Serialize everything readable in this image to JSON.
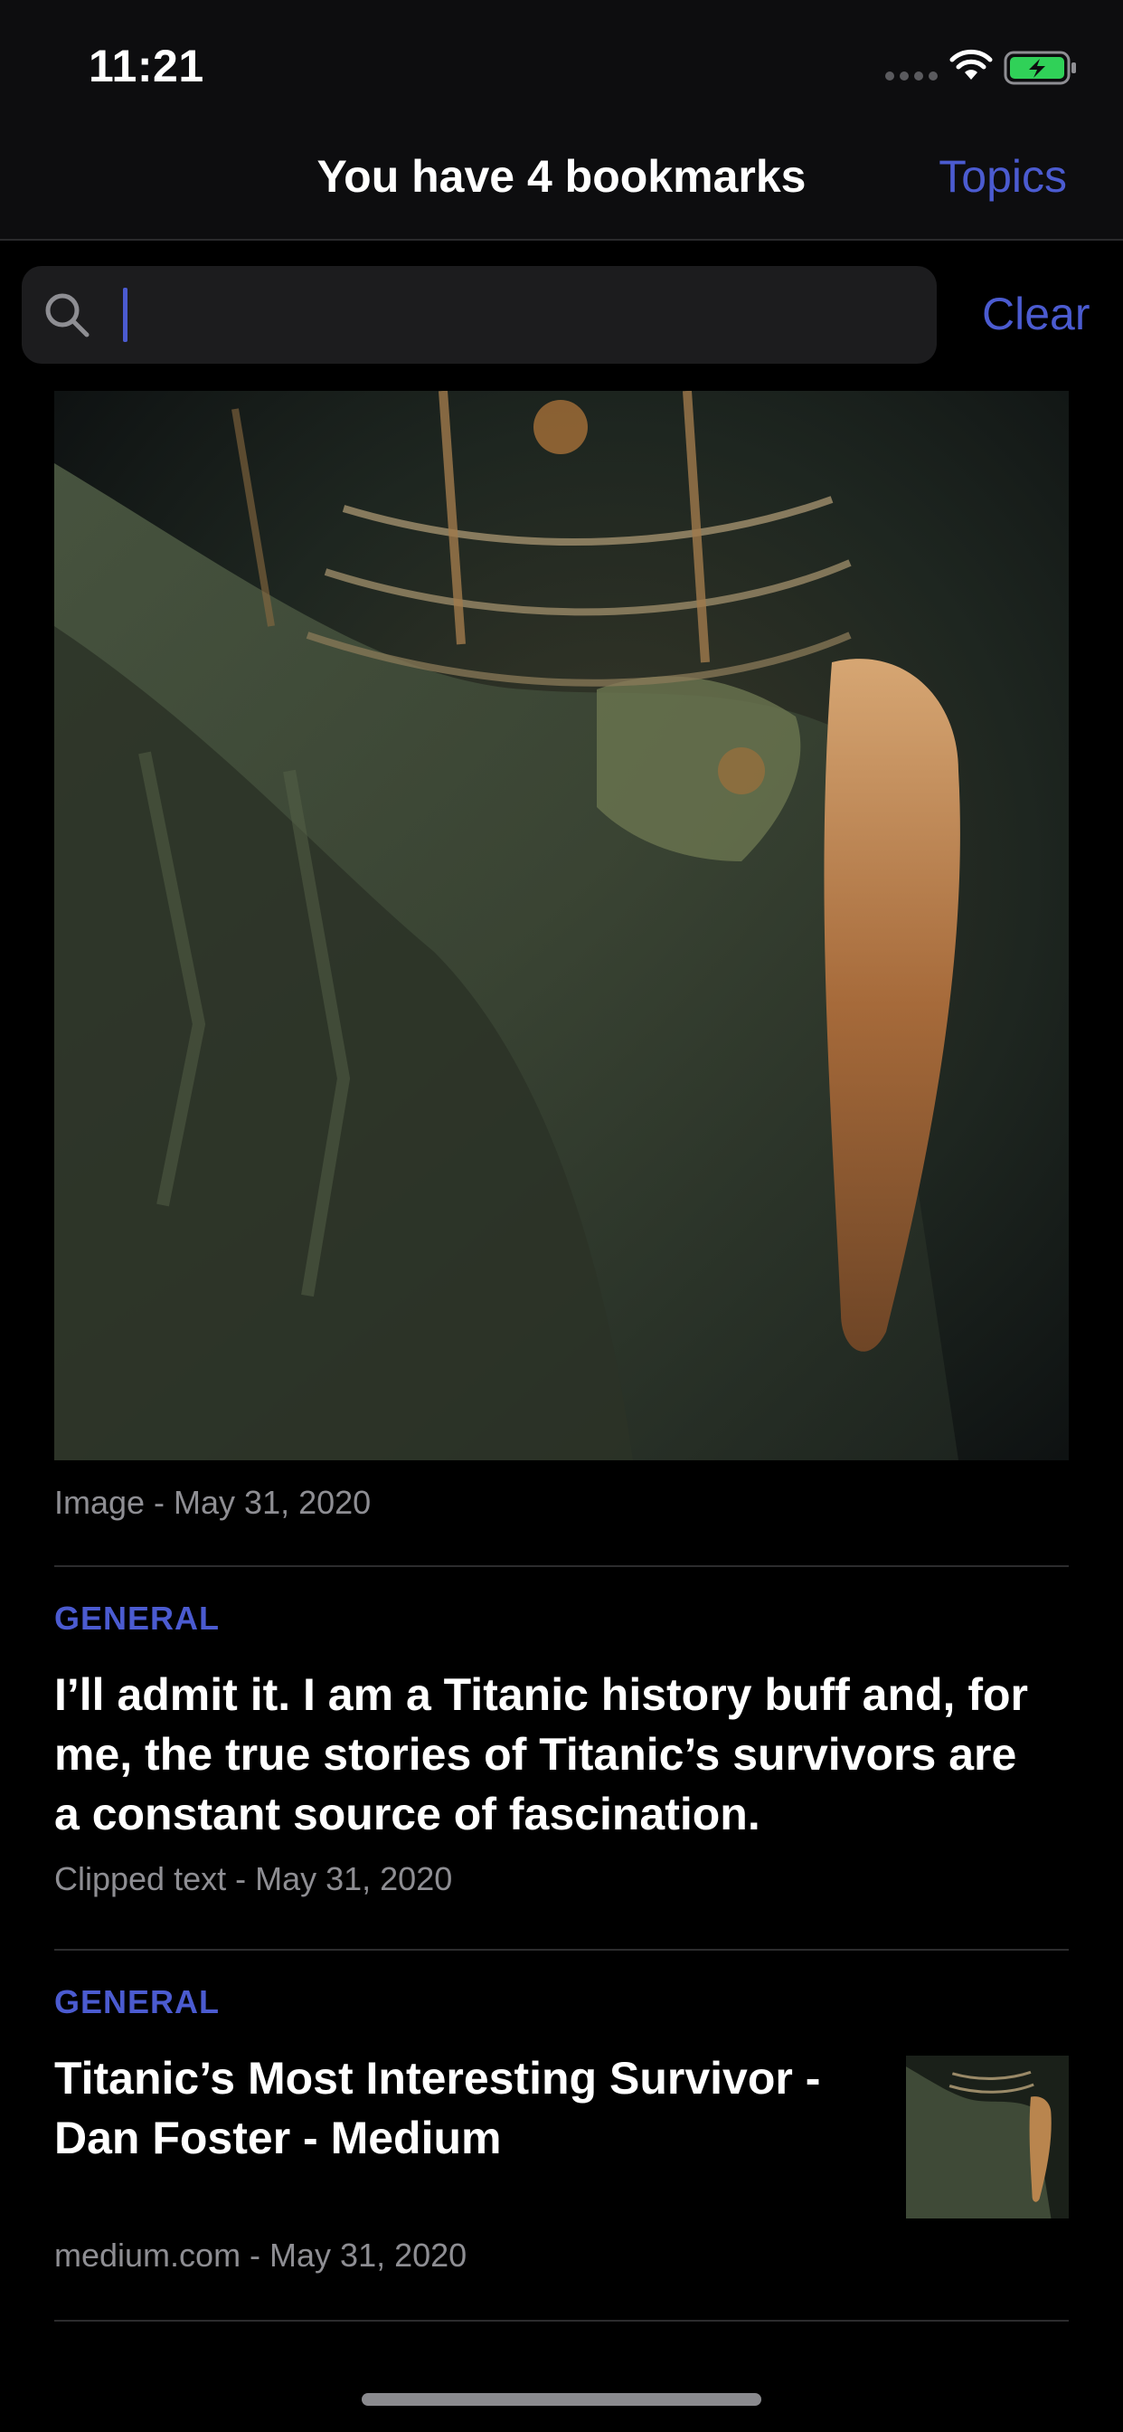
{
  "status_bar": {
    "time": "11:21"
  },
  "nav": {
    "title": "You have 4 bookmarks",
    "topics_label": "Topics"
  },
  "search": {
    "value": "",
    "clear_label": "Clear"
  },
  "bookmarks": [
    {
      "kind": "image",
      "meta": "Image - May 31, 2020"
    },
    {
      "kind": "clipped_text",
      "topic": "GENERAL",
      "title_lines": [
        "I’ll admit it. I am a Titanic history buff and, for",
        "me, the true stories of Titanic’s survivors are",
        "a constant source of fascination."
      ],
      "meta": "Clipped text - May 31, 2020"
    },
    {
      "kind": "link",
      "topic": "GENERAL",
      "title_lines": [
        "Titanic’s Most Interesting Survivor -",
        "Dan Foster - Medium"
      ],
      "meta": "medium.com - May 31, 2020"
    }
  ],
  "icons": {
    "signal": "signal-dots-icon",
    "wifi": "wifi-icon",
    "battery": "battery-charging-icon",
    "search": "search-icon"
  },
  "colors": {
    "accent": "#4b5bd0",
    "background": "#000000",
    "secondary_text": "#8e8e93",
    "battery_fill": "#30d158"
  }
}
